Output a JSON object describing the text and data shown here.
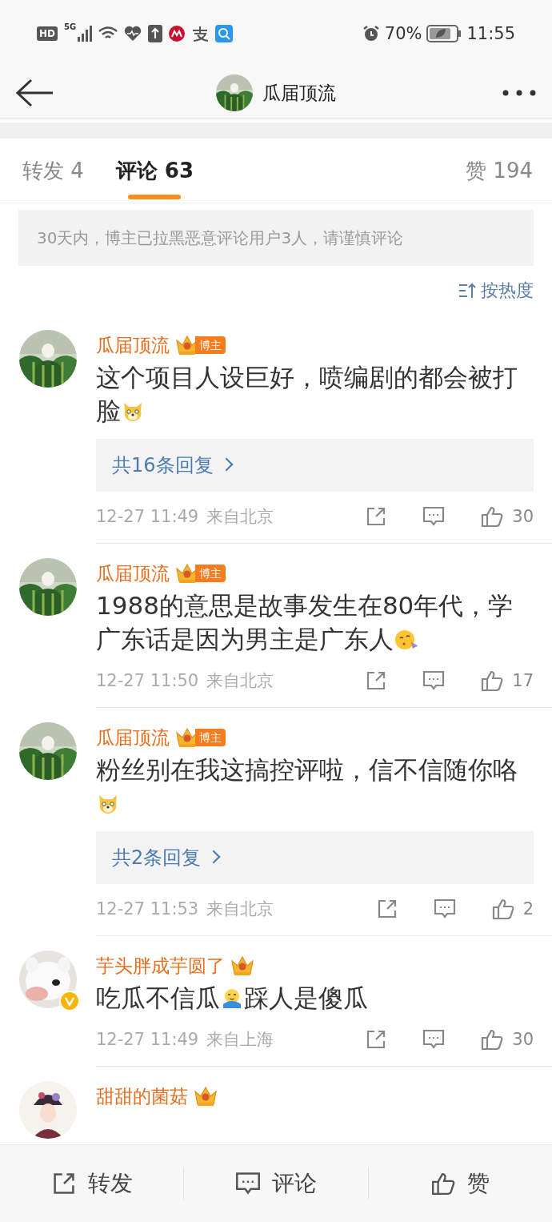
{
  "status_bar": {
    "hd": "HD",
    "network": "5G",
    "battery": "70%",
    "time": "11:55"
  },
  "header": {
    "title": "瓜届顶流"
  },
  "tabs": [
    {
      "label": "转发 4",
      "selected": false
    },
    {
      "label": "评论 63",
      "selected": true
    },
    {
      "label": "赞 194",
      "selected": false
    }
  ],
  "notice": "30天内，博主已拉黑恶意评论用户3人，请谨慎评论",
  "sort": {
    "label": "按热度"
  },
  "comments": [
    {
      "name": "瓜届顶流",
      "badge": {
        "kind": "blogger",
        "label": "博主"
      },
      "verified": false,
      "segments": [
        {
          "kind": "text",
          "text": "这个项目人设巨好，喷编剧的都会被打脸"
        },
        {
          "kind": "doge"
        }
      ],
      "replies": "共16条回复",
      "time": "12-27 11:49",
      "location": "来自北京",
      "likes": "30"
    },
    {
      "name": "瓜届顶流",
      "badge": {
        "kind": "blogger",
        "label": "博主"
      },
      "verified": false,
      "segments": [
        {
          "kind": "text",
          "text": "1988的意思是故事发生在80年代，学广东话是因为男主是广东人"
        },
        {
          "kind": "kiss"
        }
      ],
      "time": "12-27 11:50",
      "location": "来自北京",
      "likes": "17"
    },
    {
      "name": "瓜届顶流",
      "badge": {
        "kind": "blogger",
        "label": "博主"
      },
      "verified": false,
      "segments": [
        {
          "kind": "text",
          "text": "粉丝别在我这搞控评啦，信不信随你咯"
        },
        {
          "kind": "doge"
        }
      ],
      "replies": "共2条回复",
      "time": "12-27 11:53",
      "location": "来自北京",
      "likes": "2"
    },
    {
      "name": "芋头胖成芋圆了",
      "badge": {
        "kind": "crown"
      },
      "verified": true,
      "segments": [
        {
          "kind": "text",
          "text": "吃瓜不信瓜"
        },
        {
          "kind": "hug"
        },
        {
          "kind": "text",
          "text": "踩人是傻瓜"
        }
      ],
      "time": "12-27 11:49",
      "location": "来自上海",
      "likes": "30"
    },
    {
      "name": "甜甜的菌菇",
      "badge": {
        "kind": "crown"
      },
      "verified": false
    }
  ],
  "bottom_bar": [
    {
      "kind": "repost",
      "label": "转发"
    },
    {
      "kind": "comment",
      "label": "评论"
    },
    {
      "kind": "like",
      "label": "赞"
    }
  ]
}
